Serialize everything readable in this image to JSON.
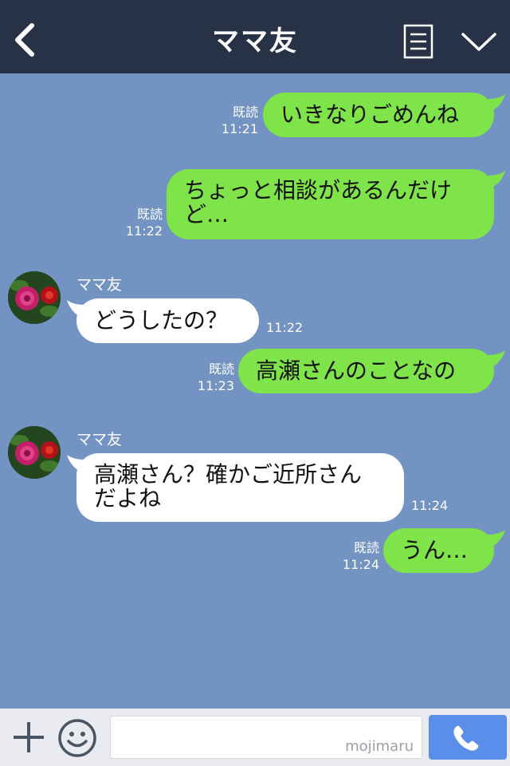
{
  "header": {
    "title": "ママ友"
  },
  "messages": [
    {
      "dir": "out",
      "lines": [
        "いきなりごめんね"
      ],
      "read": "既読",
      "time": "11:21"
    },
    {
      "dir": "out",
      "lines": [
        "ちょっと相談があるんだけ",
        "ど…"
      ],
      "read": "既読",
      "time": "11:22"
    },
    {
      "dir": "in",
      "sender": "ママ友",
      "lines": [
        "どうしたの？"
      ],
      "time": "11:22"
    },
    {
      "dir": "out",
      "lines": [
        "高瀬さんのことなの"
      ],
      "read": "既読",
      "time": "11:23"
    },
    {
      "dir": "in",
      "sender": "ママ友",
      "lines": [
        "高瀬さん？確かご近所さん",
        "だよね"
      ],
      "time": "11:24"
    },
    {
      "dir": "out",
      "lines": [
        "うん…"
      ],
      "read": "既読",
      "time": "11:24"
    }
  ],
  "footer": {
    "watermark": "mojimaru"
  },
  "colors": {
    "header_bg": "#273246",
    "chat_bg": "#7393c2",
    "outgoing_bubble": "#7fe34a",
    "incoming_bubble": "#ffffff",
    "call_button": "#5b8ee8"
  }
}
